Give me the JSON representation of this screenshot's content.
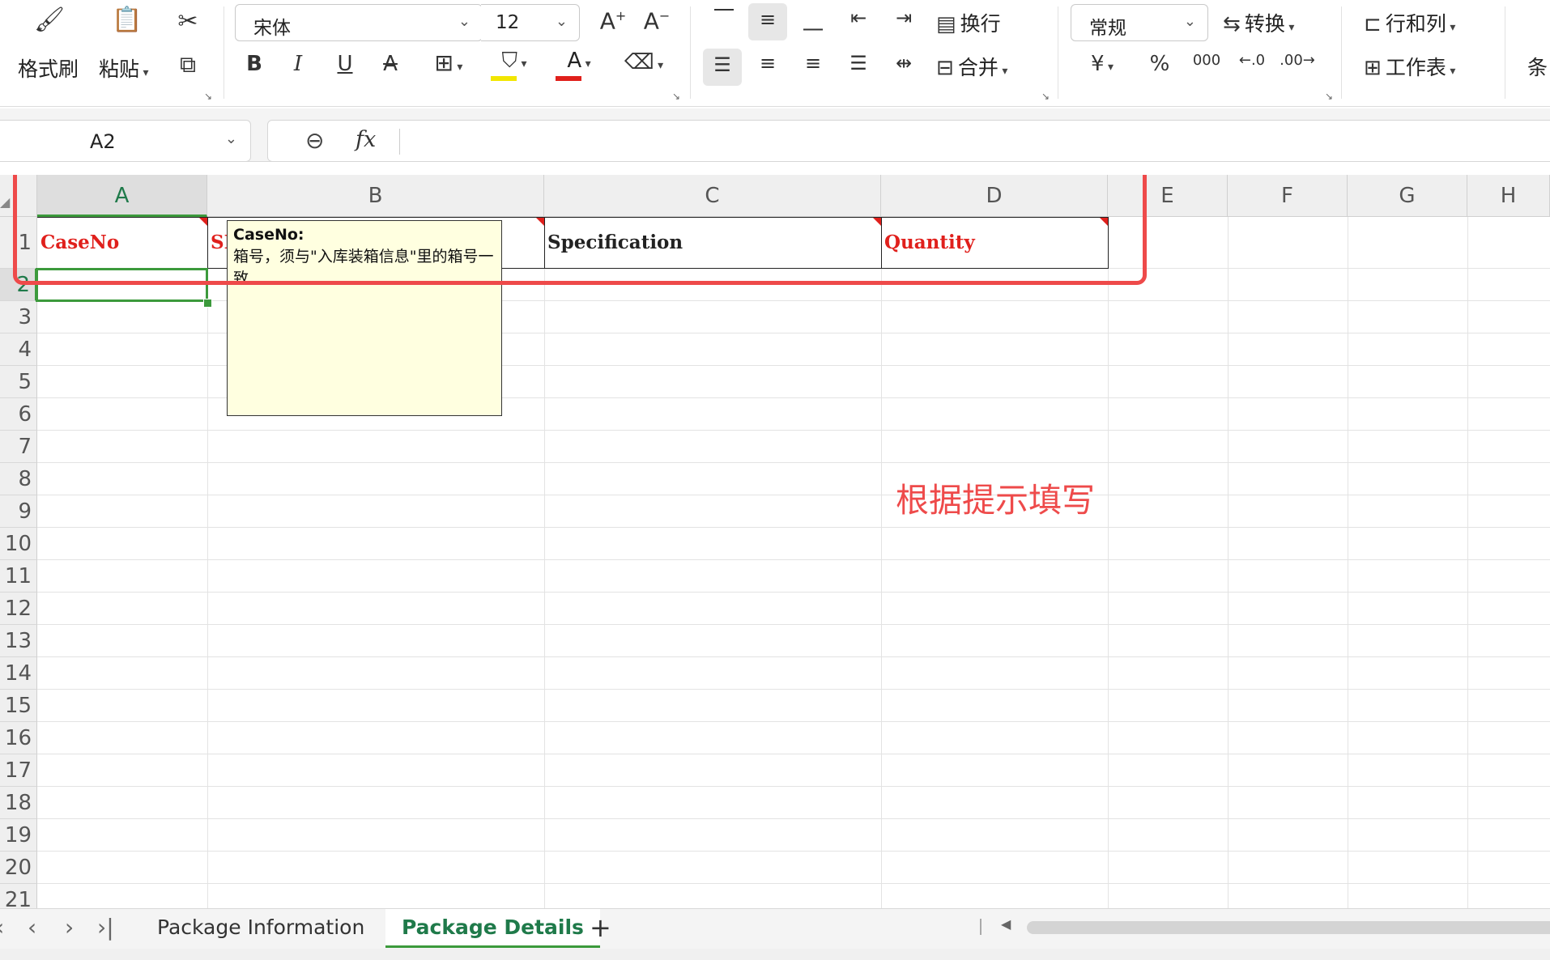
{
  "ribbon": {
    "clipboard": {
      "format_painter": "格式刷",
      "paste": "粘贴"
    },
    "font": {
      "family": "宋体",
      "size": "12"
    },
    "alignment": {
      "wrap": "换行",
      "merge": "合并"
    },
    "number": {
      "format": "常规",
      "convert": "转换",
      "currency_symbol": "¥",
      "percent_symbol": "%",
      "thousands_symbol": "000"
    },
    "cells": {
      "rows_cols": "行和列",
      "worksheet": "工作表",
      "conditional": "条"
    },
    "colors": {
      "fill_bar": "#f2e600",
      "font_bar": "#e0201c"
    }
  },
  "formula_bar": {
    "cell_ref": "A2",
    "fx_label": "fx",
    "content": ""
  },
  "grid": {
    "columns": [
      "A",
      "B",
      "C",
      "D",
      "E",
      "F",
      "G",
      "H"
    ],
    "selected_column": "A",
    "rows": [
      "1",
      "2",
      "3",
      "4",
      "5",
      "6",
      "7",
      "8",
      "9",
      "10",
      "11",
      "12",
      "13",
      "14",
      "15",
      "16",
      "17",
      "18",
      "19",
      "20",
      "21"
    ],
    "selected_row": "2",
    "header_row": [
      {
        "col": "A",
        "text": "CaseNo",
        "color": "#e0201c",
        "has_comment": true
      },
      {
        "col": "B",
        "text": "SKU",
        "color": "#e0201c",
        "has_comment": true
      },
      {
        "col": "C",
        "text": "Specification",
        "color": "#222222",
        "has_comment": true
      },
      {
        "col": "D",
        "text": "Quantity",
        "color": "#e0201c",
        "has_comment": true
      }
    ]
  },
  "comment": {
    "title": "CaseNo:",
    "body": "箱号，须与\"入库装箱信息\"里的箱号一致"
  },
  "annotation": {
    "text": "根据提示填写",
    "color": "#ee4a4a"
  },
  "sheets": {
    "tabs": [
      {
        "label": "Package Information",
        "active": false
      },
      {
        "label": "Package Details",
        "active": true
      }
    ],
    "add_label": "+"
  }
}
